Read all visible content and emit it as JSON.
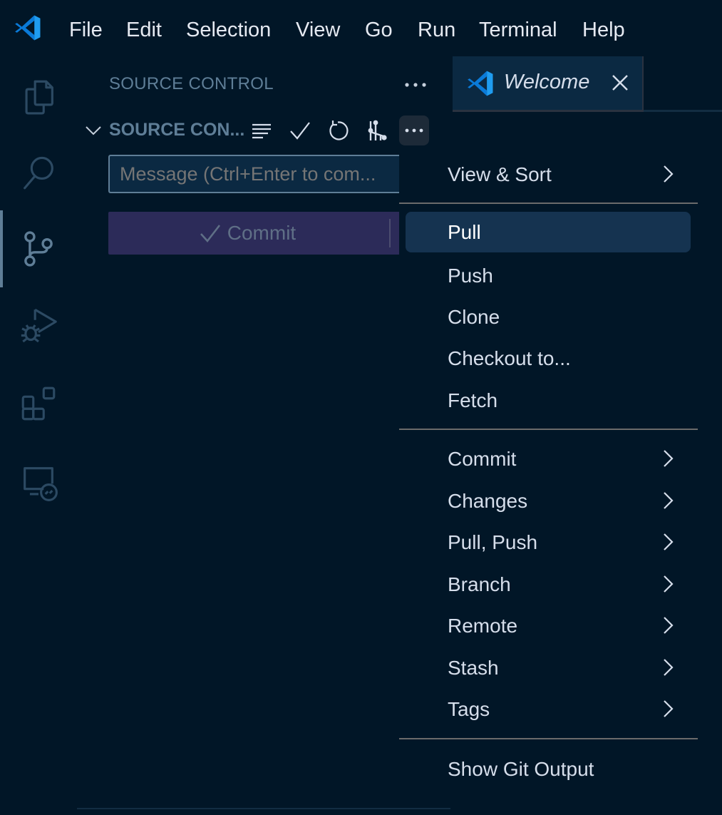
{
  "app": {
    "name": "Visual Studio Code",
    "logo_icon": "vscode-logo-icon",
    "brand_color": "#1e90e0"
  },
  "menubar": {
    "items": [
      "File",
      "Edit",
      "Selection",
      "View",
      "Go",
      "Run",
      "Terminal",
      "Help"
    ]
  },
  "activity_bar": {
    "items": [
      {
        "name": "Explorer",
        "icon": "files-icon",
        "active": false
      },
      {
        "name": "Search",
        "icon": "search-icon",
        "active": false
      },
      {
        "name": "Source Control",
        "icon": "source-control-icon",
        "active": true
      },
      {
        "name": "Run and Debug",
        "icon": "run-debug-icon",
        "active": false
      },
      {
        "name": "Extensions",
        "icon": "extensions-icon",
        "active": false
      },
      {
        "name": "Remote Explorer",
        "icon": "remote-explorer-icon",
        "active": false
      }
    ]
  },
  "sidebar": {
    "title": "SOURCE CONTROL",
    "more_icon": "ellipsis-icon",
    "section": {
      "title": "SOURCE CON...",
      "expanded": true,
      "actions": [
        {
          "name": "View as Tree",
          "icon": "list-icon"
        },
        {
          "name": "Commit",
          "icon": "check-icon"
        },
        {
          "name": "Refresh",
          "icon": "refresh-icon"
        },
        {
          "name": "Open Graph",
          "icon": "graph-icon"
        },
        {
          "name": "More Actions",
          "icon": "ellipsis-icon",
          "active": true
        }
      ]
    },
    "message_input": {
      "value": "",
      "placeholder": "Message (Ctrl+Enter to com..."
    },
    "commit_button": {
      "label": "Commit",
      "icon": "check-icon",
      "enabled": false
    }
  },
  "editor": {
    "tabs": [
      {
        "label": "Welcome",
        "icon": "vscode-logo-icon",
        "active": true,
        "italic": true,
        "close_icon": "close-icon"
      }
    ]
  },
  "context_menu": {
    "groups": [
      [
        {
          "label": "View & Sort",
          "submenu": true
        }
      ],
      [
        {
          "label": "Pull",
          "submenu": false,
          "selected": true
        },
        {
          "label": "Push",
          "submenu": false
        },
        {
          "label": "Clone",
          "submenu": false
        },
        {
          "label": "Checkout to...",
          "submenu": false
        },
        {
          "label": "Fetch",
          "submenu": false
        }
      ],
      [
        {
          "label": "Commit",
          "submenu": true
        },
        {
          "label": "Changes",
          "submenu": true
        },
        {
          "label": "Pull, Push",
          "submenu": true
        },
        {
          "label": "Branch",
          "submenu": true
        },
        {
          "label": "Remote",
          "submenu": true
        },
        {
          "label": "Stash",
          "submenu": true
        },
        {
          "label": "Tags",
          "submenu": true
        }
      ],
      [
        {
          "label": "Show Git Output",
          "submenu": false
        }
      ]
    ]
  },
  "theme": {
    "background": "#011627",
    "foreground": "#d6deeb",
    "muted": "#5f7e97",
    "input_background": "#0b2942",
    "button_background": "#2c2b59",
    "menu_selection": "#153350",
    "separator": "#6b6b6b"
  }
}
